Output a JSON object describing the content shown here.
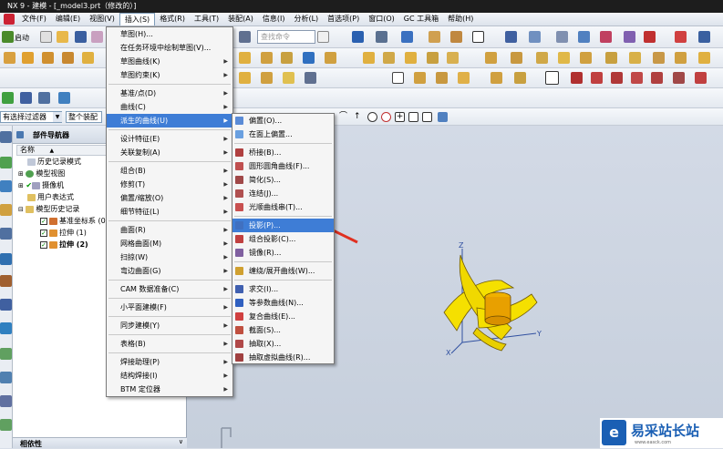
{
  "window": {
    "title": "NX 9 - 建模 - [_model3.prt（修改的）]"
  },
  "menubar": [
    "文件(F)",
    "编辑(E)",
    "视图(V)",
    "插入(S)",
    "格式(R)",
    "工具(T)",
    "装配(A)",
    "信息(I)",
    "分析(L)",
    "首选项(P)",
    "窗口(O)",
    "GC 工具箱",
    "帮助(H)"
  ],
  "toolbar": {
    "start_label": "启动",
    "search_placeholder": "查找命令",
    "filter_label": "有选择过滤器",
    "scope_label": "整个装配"
  },
  "insert_menu": [
    {
      "label": "草图(H)...",
      "arrow": false
    },
    {
      "label": "在任务环境中绘制草图(V)...",
      "arrow": false
    },
    {
      "label": "草图曲线(K)",
      "arrow": true
    },
    {
      "label": "草图约束(K)",
      "arrow": true
    },
    {
      "sep": true
    },
    {
      "label": "基准/点(D)",
      "arrow": true
    },
    {
      "label": "曲线(C)",
      "arrow": true
    },
    {
      "label": "派生的曲线(U)",
      "arrow": true,
      "active": true
    },
    {
      "sep": true
    },
    {
      "label": "设计特征(E)",
      "arrow": true
    },
    {
      "label": "关联复制(A)",
      "arrow": true
    },
    {
      "sep": true
    },
    {
      "label": "组合(B)",
      "arrow": true
    },
    {
      "label": "修剪(T)",
      "arrow": true
    },
    {
      "label": "偏置/缩放(O)",
      "arrow": true
    },
    {
      "label": "细节特征(L)",
      "arrow": true
    },
    {
      "sep": true
    },
    {
      "label": "曲面(R)",
      "arrow": true
    },
    {
      "label": "网格曲面(M)",
      "arrow": true
    },
    {
      "label": "扫掠(W)",
      "arrow": true
    },
    {
      "label": "弯边曲面(G)",
      "arrow": true
    },
    {
      "sep": true
    },
    {
      "label": "CAM 数据准备(C)",
      "arrow": true
    },
    {
      "sep": true
    },
    {
      "label": "小平面建模(F)",
      "arrow": true
    },
    {
      "sep": true
    },
    {
      "label": "同步建模(Y)",
      "arrow": true
    },
    {
      "sep": true
    },
    {
      "label": "表格(B)",
      "arrow": true
    },
    {
      "sep": true
    },
    {
      "label": "焊接助理(P)",
      "arrow": true
    },
    {
      "label": "结构焊接(I)",
      "arrow": true
    },
    {
      "label": "BTM 定位器",
      "arrow": true
    }
  ],
  "derived_menu": [
    {
      "label": "偏置(O)...",
      "color": "#5a8bd6"
    },
    {
      "label": "在面上偏置...",
      "color": "#6aa0e0"
    },
    {
      "sep": true
    },
    {
      "label": "桥接(B)...",
      "color": "#b04040"
    },
    {
      "label": "圆形圆角曲线(F)...",
      "color": "#c05050"
    },
    {
      "label": "简化(S)...",
      "color": "#a04848"
    },
    {
      "label": "连结(J)...",
      "color": "#b05050"
    },
    {
      "label": "光顺曲线串(T)...",
      "color": "#c85050"
    },
    {
      "sep": true
    },
    {
      "label": "投影(P)...",
      "color": "#4070c0",
      "highlight": true
    },
    {
      "label": "组合投影(C)...",
      "color": "#c04040"
    },
    {
      "label": "镜像(R)...",
      "color": "#8060a0"
    },
    {
      "sep": true
    },
    {
      "label": "缠绕/展开曲线(W)...",
      "color": "#d0a030"
    },
    {
      "sep": true
    },
    {
      "label": "求交(I)...",
      "color": "#4060b0"
    },
    {
      "label": "等参数曲线(N)...",
      "color": "#3060c0"
    },
    {
      "label": "复合曲线(E)...",
      "color": "#d04040"
    },
    {
      "label": "截面(S)...",
      "color": "#c05040"
    },
    {
      "label": "抽取(X)...",
      "color": "#b04848"
    },
    {
      "label": "抽取虚拟曲线(R)...",
      "color": "#a04040"
    }
  ],
  "navigator": {
    "title": "部件导航器",
    "column": "名称",
    "items": [
      "历史记录模式",
      "模型视图",
      "摄像机",
      "用户表达式",
      "模型历史记录",
      "基准坐标系 (0)",
      "拉伸 (1)",
      "拉伸 (2)"
    ]
  },
  "bottom_panel_title": "相依性",
  "axes": {
    "z": "Z",
    "y": "Y",
    "x": "X"
  },
  "watermark": {
    "text": "易采站长站",
    "sub": "www.easck.com"
  }
}
